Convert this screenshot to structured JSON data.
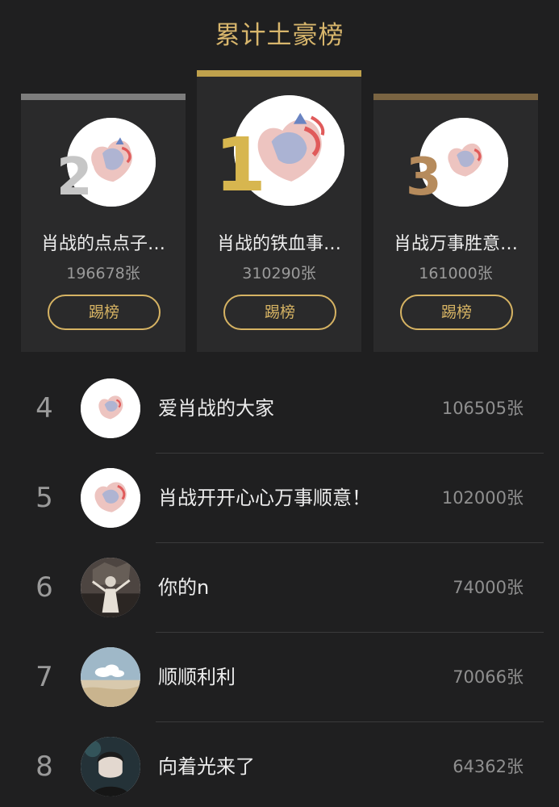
{
  "title": "累计土豪榜",
  "podium": [
    {
      "rank": "2",
      "name": "肖战的点点子…",
      "count": "196678张",
      "button": "踢榜",
      "avatar_icon": "heart-painting-avatar"
    },
    {
      "rank": "1",
      "name": "肖战的铁血事…",
      "count": "310290张",
      "button": "踢榜",
      "avatar_icon": "heart-painting-avatar"
    },
    {
      "rank": "3",
      "name": "肖战万事胜意…",
      "count": "161000张",
      "button": "踢榜",
      "avatar_icon": "heart-painting-avatar"
    }
  ],
  "list": [
    {
      "rank": "4",
      "name": "爱肖战的大家",
      "count": "106505张",
      "avatar_icon": "heart-painting-avatar"
    },
    {
      "rank": "5",
      "name": "肖战开开心心万事顺意！",
      "count": "102000张",
      "avatar_icon": "heart-painting-avatar"
    },
    {
      "rank": "6",
      "name": "你的n",
      "count": "74000张",
      "avatar_icon": "photo-avatar"
    },
    {
      "rank": "7",
      "name": "顺顺利利",
      "count": "70066张",
      "avatar_icon": "cloud-desert-avatar"
    },
    {
      "rank": "8",
      "name": "向着光来了",
      "count": "64362张",
      "avatar_icon": "portrait-avatar"
    }
  ],
  "colors": {
    "background": "#1f1f20",
    "gold": "#d6b363",
    "silver_bar": "#7d7d7d",
    "gold_bar": "#bfa14c",
    "bronze_bar": "#7a6442"
  }
}
